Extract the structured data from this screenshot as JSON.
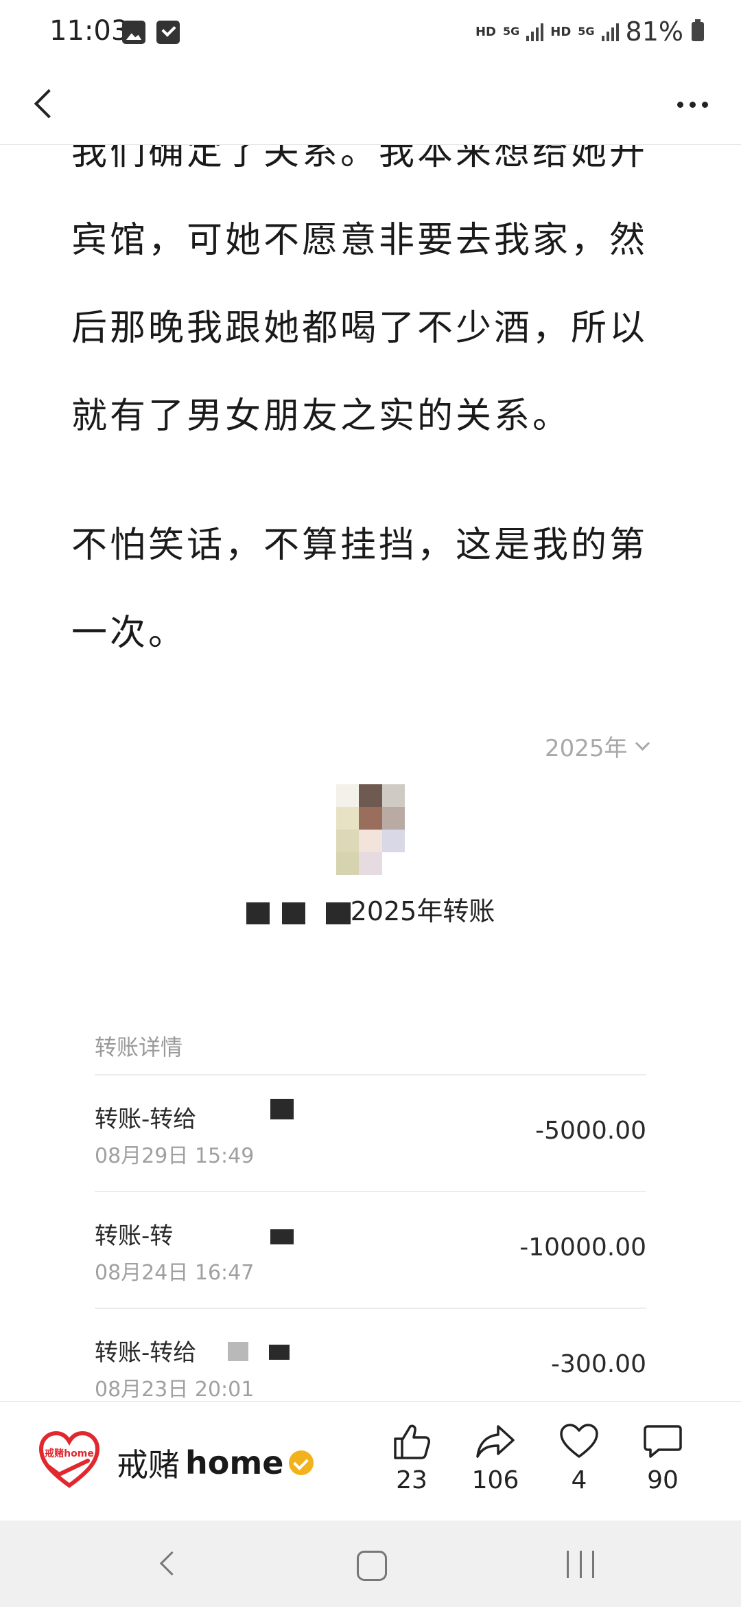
{
  "status_bar": {
    "time": "11:03",
    "hd1": "HD",
    "net1": "5G",
    "hd2": "HD",
    "net2": "5G",
    "battery": "81%"
  },
  "article": {
    "para1": "我们确定了关系。我本来想给她开宾馆，可她不愿意非要去我家，然后那晚我跟她都喝了不少酒，所以就有了男女朋友之实的关系。",
    "para2": "不怕笑话，不算挂挡，这是我的第一次。"
  },
  "embedded_screenshot": {
    "year_filter": "2025年",
    "title_suffix": "2025年转账",
    "details_label": "转账详情",
    "transactions": [
      {
        "name": "转账-转给",
        "time": "08月29日 15:49",
        "amount": "-5000.00"
      },
      {
        "name": "转账-转",
        "time": "08月24日 16:47",
        "amount": "-10000.00"
      },
      {
        "name": "转账-转给",
        "time": "08月23日 20:01",
        "amount": "-300.00"
      }
    ]
  },
  "action_bar": {
    "brand_cn": "戒赌",
    "brand_en": "home",
    "logo_text": "戒赌home",
    "like_count": "23",
    "share_count": "106",
    "favorite_count": "4",
    "comment_count": "90"
  },
  "colors": {
    "brand_red": "#e0282e",
    "verified_gold": "#f2b21b"
  }
}
